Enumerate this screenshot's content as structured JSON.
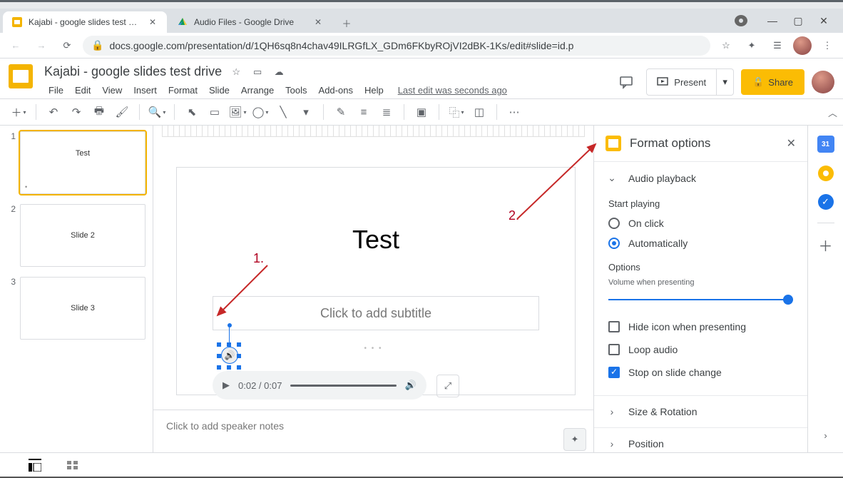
{
  "browser": {
    "tabs": [
      {
        "title": "Kajabi - google slides test drive -",
        "active": true
      },
      {
        "title": "Audio Files - Google Drive",
        "active": false
      }
    ],
    "url": "docs.google.com/presentation/d/1QH6sq8n4chav49ILRGfLX_GDm6FKbyROjVI2dBK-1Ks/edit#slide=id.p"
  },
  "doc": {
    "title": "Kajabi - google slides test drive",
    "menus": [
      "File",
      "Edit",
      "View",
      "Insert",
      "Format",
      "Slide",
      "Arrange",
      "Tools",
      "Add-ons",
      "Help"
    ],
    "last_edit": "Last edit was seconds ago",
    "present": "Present",
    "share": "Share"
  },
  "filmstrip": [
    {
      "num": "1",
      "label": "Test",
      "selected": true
    },
    {
      "num": "2",
      "label": "Slide 2",
      "selected": false
    },
    {
      "num": "3",
      "label": "Slide 3",
      "selected": false
    }
  ],
  "slide": {
    "title": "Test",
    "subtitle_placeholder": "Click to add subtitle"
  },
  "player": {
    "time": "0:02 / 0:07"
  },
  "notes_placeholder": "Click to add speaker notes",
  "annotations": {
    "a1": "1.",
    "a2": "2."
  },
  "format_panel": {
    "title": "Format options",
    "audio_playback": "Audio playback",
    "start_playing": "Start playing",
    "on_click": "On click",
    "automatically": "Automatically",
    "options": "Options",
    "volume_hint": "Volume when presenting",
    "hide_icon": "Hide icon when presenting",
    "loop_audio": "Loop audio",
    "stop_on_change": "Stop on slide change",
    "size_rotation": "Size & Rotation",
    "position": "Position"
  },
  "siderail": {
    "calendar": "31"
  }
}
